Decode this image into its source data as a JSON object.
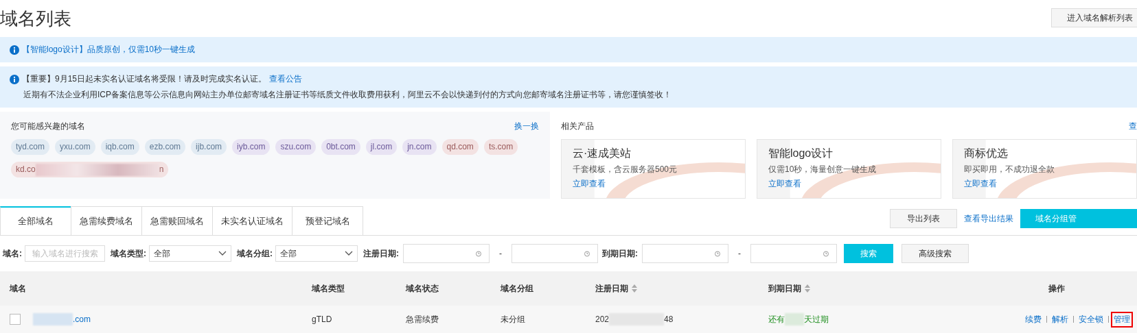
{
  "page_title": "域名列表",
  "header_button": "进入域名解析列表",
  "notices": [
    {
      "lead": "【智能logo设计】品质原创，仅需10秒一键生成"
    },
    {
      "lead": "【重要】9月15日起未实名认证域名将受限！请及时完成实名认证。",
      "link": "查看公告",
      "lines": [
        "近期有不法企业利用ICP备案信息等公示信息向网站主办单位邮寄域名注册证书等纸质文件收取费用获利，阿里云不会以快递到付的方式向您邮寄域名注册证书等，请您谨慎签收！"
      ]
    }
  ],
  "suggestions": {
    "title": "您可能感兴趣的域名",
    "refresh": "换一换",
    "chips": [
      {
        "text": "tyd.com",
        "color": "#e2ebf3"
      },
      {
        "text": "yxu.com",
        "color": "#e2ebf3"
      },
      {
        "text": "iqb.com",
        "color": "#e2ebf3"
      },
      {
        "text": "ezb.com",
        "color": "#e2ebf3"
      },
      {
        "text": "ijb.com",
        "color": "#e2ebf3"
      },
      {
        "text": "iyb.com",
        "color": "#e8e3f3"
      },
      {
        "text": "szu.com",
        "color": "#e8e3f3"
      },
      {
        "text": "0bt.com",
        "color": "#e8e3f3"
      },
      {
        "text": "jl.com",
        "color": "#e8e3f3"
      },
      {
        "text": "jn.com",
        "color": "#e8e3f3"
      },
      {
        "text": "qd.com",
        "color": "#f3e2e2"
      },
      {
        "text": "ts.com",
        "color": "#f3e2e2"
      },
      {
        "text": "kd.co",
        "tail": "n",
        "color": "#f3e2e2"
      }
    ]
  },
  "products": {
    "title": "相关产品",
    "more": "查",
    "cards": [
      {
        "name": "云·速成美站",
        "desc": "千套模板，含云服务器500元",
        "link": "立即查看"
      },
      {
        "name": "智能logo设计",
        "desc": "仅需10秒，海量创意一键生成",
        "link": "立即查看"
      },
      {
        "name": "商标优选",
        "desc": "即买即用，不成功退全款",
        "link": "立即查看"
      }
    ]
  },
  "tabs": [
    {
      "label": "全部域名",
      "selected": true
    },
    {
      "label": "急需续费域名",
      "selected": false
    },
    {
      "label": "急需赎回域名",
      "selected": false
    },
    {
      "label": "未实名认证域名",
      "selected": false
    },
    {
      "label": "预登记域名",
      "selected": false
    }
  ],
  "tab_actions": {
    "export": "导出列表",
    "results": "查看导出结果",
    "group": "域名分组管"
  },
  "filters": {
    "domain_label": "域名:",
    "domain_placeholder": "输入域名进行搜索",
    "type_label": "域名类型:",
    "type_value": "全部",
    "group_label": "域名分组:",
    "group_value": "全部",
    "reg_label": "注册日期:",
    "exp_label": "到期日期:",
    "dash": "-",
    "search": "搜索",
    "advanced": "高级搜索"
  },
  "table": {
    "columns": [
      {
        "label": "域名",
        "sortable": false
      },
      {
        "label": "域名类型",
        "sortable": false
      },
      {
        "label": "域名状态",
        "sortable": false
      },
      {
        "label": "域名分组",
        "sortable": false
      },
      {
        "label": "注册日期",
        "sortable": true
      },
      {
        "label": "到期日期",
        "sortable": true
      },
      {
        "label": "操作",
        "sortable": false
      }
    ],
    "rows": [
      {
        "checked": false,
        "domain_tail": ".com",
        "type": "gTLD",
        "status": "急需续费",
        "group": "未分组",
        "reg_head": "202",
        "reg_tail": "48",
        "exp_head": "还有",
        "exp_tail": "天过期",
        "actions": [
          {
            "label": "续费",
            "highlighted": false
          },
          {
            "label": "解析",
            "highlighted": false
          },
          {
            "label": "安全锁",
            "highlighted": false
          },
          {
            "label": "管理",
            "highlighted": true
          }
        ]
      }
    ]
  }
}
